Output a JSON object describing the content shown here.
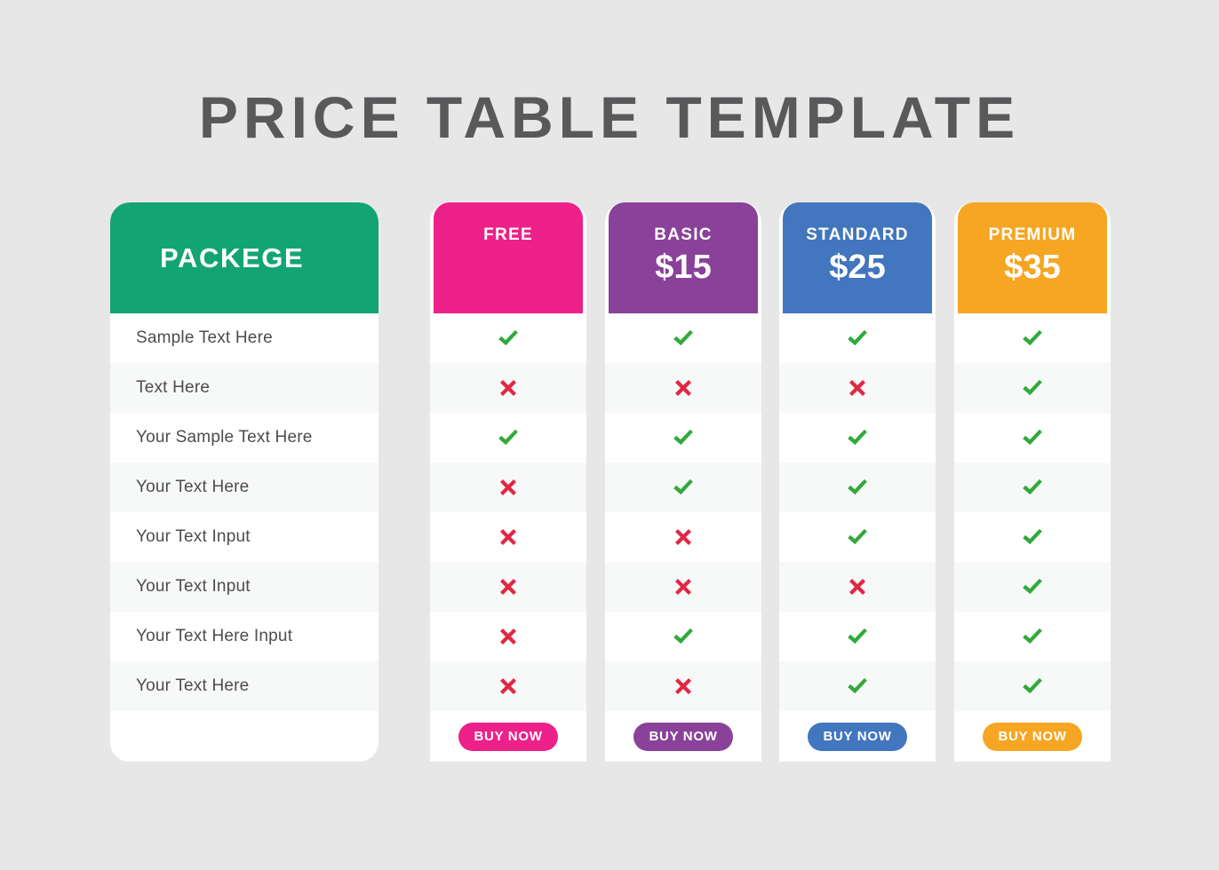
{
  "page": {
    "title": "PRICE TABLE TEMPLATE",
    "background_color": "#e7e7e7",
    "title_color": "#58595b"
  },
  "package_column": {
    "header_label": "PACKEGE",
    "header_color": "#13a474",
    "features": [
      "Sample Text Here",
      "Text Here",
      "Your Sample Text Here",
      "Your Text Here",
      "Your Text Input",
      "Your Text Input",
      "Your Text Here Input",
      "Your Text Here"
    ]
  },
  "icons": {
    "check": "check-icon",
    "cross": "cross-icon",
    "check_color": "#31a93b",
    "cross_color": "#e02843"
  },
  "plans": [
    {
      "name": "FREE",
      "price": "",
      "color": "#ed2189",
      "buy_label": "BUY NOW",
      "features": [
        "check",
        "cross",
        "check",
        "cross",
        "cross",
        "cross",
        "cross",
        "cross"
      ]
    },
    {
      "name": "BASIC",
      "price": "$15",
      "color": "#8a4199",
      "buy_label": "BUY NOW",
      "features": [
        "check",
        "cross",
        "check",
        "check",
        "cross",
        "cross",
        "check",
        "cross"
      ]
    },
    {
      "name": "STANDARD",
      "price": "$25",
      "color": "#4276be",
      "buy_label": "BUY NOW",
      "features": [
        "check",
        "cross",
        "check",
        "check",
        "check",
        "cross",
        "check",
        "check"
      ]
    },
    {
      "name": "PREMIUM",
      "price": "$35",
      "color": "#f6a623",
      "buy_label": "BUY NOW",
      "features": [
        "check",
        "check",
        "check",
        "check",
        "check",
        "check",
        "check",
        "check"
      ]
    }
  ]
}
